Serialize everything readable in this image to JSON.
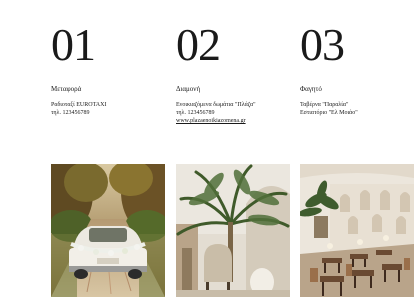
{
  "services": [
    {
      "number": "01",
      "title": "Μεταφορά",
      "lines": [
        "Ραδιοταξί EUROTAXI",
        "τηλ. 123456789"
      ],
      "image": "wedding-car-photo"
    },
    {
      "number": "02",
      "title": "Διαμονή",
      "lines": [
        "Ενοικιαζόμενα δωμάτια \"Πλάζα\"",
        "τηλ. 123456789"
      ],
      "link": "www.plazaenoikiazomena.gr",
      "image": "resort-lounge-photo"
    },
    {
      "number": "03",
      "title": "Φαγητό",
      "lines": [
        "Ταβέρνα \"Παραλία\"",
        "Εστιατόριο \"Ελ Μοιάο\""
      ],
      "image": "restaurant-interior-photo"
    }
  ]
}
